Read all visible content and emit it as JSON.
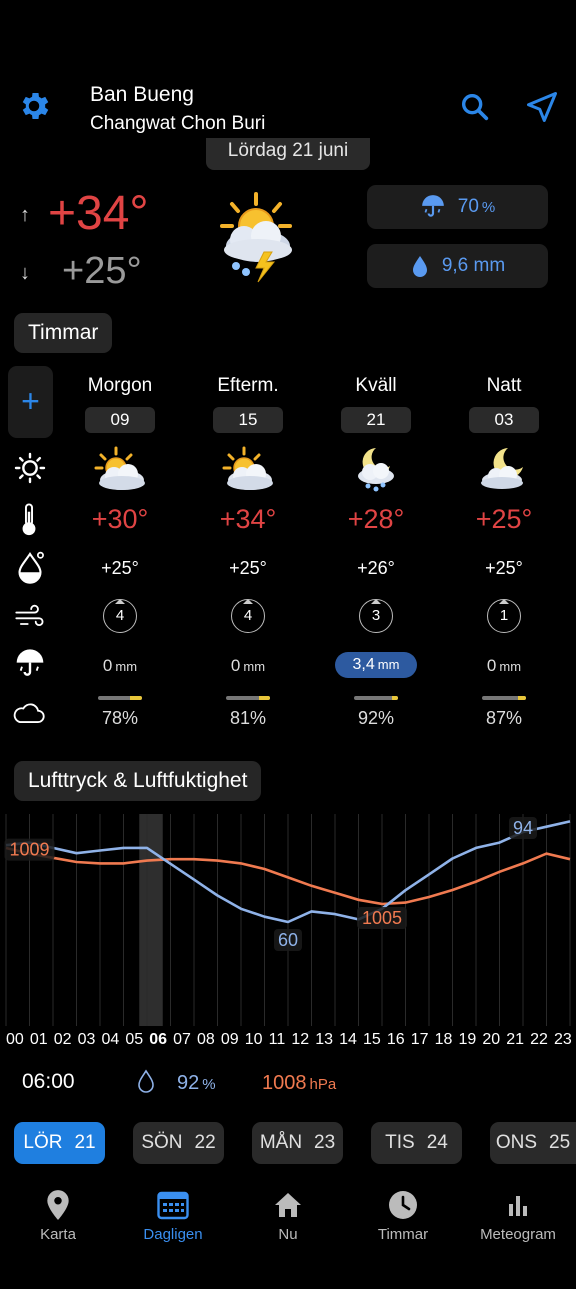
{
  "header": {
    "location": "Ban Bueng",
    "region": "Changwat Chon Buri",
    "date": "Lördag 21 juni"
  },
  "summary": {
    "high": "+34°",
    "low": "+25°",
    "high_arrow": "↑",
    "low_arrow": "↓",
    "precip_chance": "70",
    "precip_chance_unit": "%",
    "precip_amount": "9,6 mm",
    "weather_icon": "sun-cloud-thunder-icon"
  },
  "hourly": {
    "title": "Timmar",
    "plus": "+",
    "columns": [
      {
        "label": "Morgon",
        "hour": "09",
        "icon": "sun-cloud-icon",
        "temp": "+30°",
        "dew": "+25°",
        "wind": "4",
        "precip": "0",
        "precip_unit": "mm",
        "precip_highlight": false,
        "cloud_fraction": 0.78,
        "cloud": "78%"
      },
      {
        "label": "Efterm.",
        "hour": "15",
        "icon": "sun-cloud-icon",
        "temp": "+34°",
        "dew": "+25°",
        "wind": "4",
        "precip": "0",
        "precip_unit": "mm",
        "precip_highlight": false,
        "cloud_fraction": 0.81,
        "cloud": "81%"
      },
      {
        "label": "Kväll",
        "hour": "21",
        "icon": "moon-cloud-rain-icon",
        "temp": "+28°",
        "dew": "+26°",
        "wind": "3",
        "precip": "3,4",
        "precip_unit": "mm",
        "precip_highlight": true,
        "cloud_fraction": 0.92,
        "cloud": "92%"
      },
      {
        "label": "Natt",
        "hour": "03",
        "icon": "moon-cloud-icon",
        "temp": "+25°",
        "dew": "+25°",
        "wind": "1",
        "precip": "0",
        "precip_unit": "mm",
        "precip_highlight": false,
        "cloud_fraction": 0.87,
        "cloud": "87%"
      }
    ]
  },
  "pressure": {
    "title": "Lufttryck & Luftfuktighet",
    "hours": [
      "00",
      "01",
      "02",
      "03",
      "04",
      "05",
      "06",
      "07",
      "08",
      "09",
      "10",
      "11",
      "12",
      "13",
      "14",
      "15",
      "16",
      "17",
      "18",
      "19",
      "20",
      "21",
      "22",
      "23"
    ],
    "current_hour": "06",
    "readout_time": "06:00",
    "readout_humidity": "92",
    "readout_humidity_unit": "%",
    "readout_pressure": "1008",
    "readout_pressure_unit": "hPa"
  },
  "chart_data": {
    "type": "line",
    "x": [
      0,
      1,
      2,
      3,
      4,
      5,
      6,
      7,
      8,
      9,
      10,
      11,
      12,
      13,
      14,
      15,
      16,
      17,
      18,
      19,
      20,
      21,
      22,
      23,
      24
    ],
    "series": [
      {
        "values": [
          89,
          90,
          88,
          86,
          87,
          88,
          88,
          82,
          76,
          70,
          65,
          62,
          60,
          64,
          63,
          61,
          65,
          72,
          78,
          84,
          88,
          90,
          94,
          96,
          98
        ]
      },
      {
        "values": [
          1009,
          1008.6,
          1008.3,
          1008.0,
          1007.9,
          1007.9,
          1008.1,
          1008.2,
          1008.2,
          1008.1,
          1007.9,
          1007.5,
          1006.9,
          1006.3,
          1005.8,
          1005.3,
          1005.0,
          1005.1,
          1005.5,
          1006.0,
          1006.6,
          1007.3,
          1007.9,
          1008.6,
          1008.2
        ]
      }
    ],
    "annotations": [
      {
        "label": "1009",
        "x": 1,
        "series": 1
      },
      {
        "label": "1005",
        "x": 16,
        "series": 1
      },
      {
        "label": "60",
        "x": 12,
        "series": 0
      },
      {
        "label": "94",
        "x": 22,
        "series": 0
      }
    ],
    "highlight_x": 6,
    "colors": {
      "humidity": "#8fb2e8",
      "pressure": "#f07a50",
      "highlight": "#2e2e2e"
    }
  },
  "days": [
    {
      "name": "LÖR",
      "num": "21",
      "active": true
    },
    {
      "name": "SÖN",
      "num": "22",
      "active": false
    },
    {
      "name": "MÅN",
      "num": "23",
      "active": false
    },
    {
      "name": "TIS",
      "num": "24",
      "active": false
    },
    {
      "name": "ONS",
      "num": "25",
      "active": false
    }
  ],
  "nav": [
    {
      "label": "Karta",
      "icon": "map-pin-icon"
    },
    {
      "label": "Dagligen",
      "icon": "calendar-icon",
      "active": true
    },
    {
      "label": "Nu",
      "icon": "home-icon"
    },
    {
      "label": "Timmar",
      "icon": "clock-icon"
    },
    {
      "label": "Meteogram",
      "icon": "bar-chart-icon"
    }
  ],
  "colors": {
    "accent": "#1f7fe0",
    "hot": "#e04444",
    "precip": "#5a9af0"
  }
}
